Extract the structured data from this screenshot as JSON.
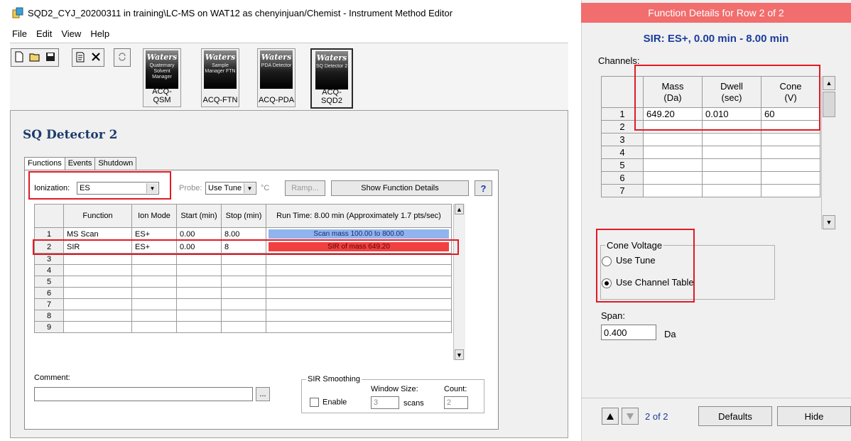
{
  "window": {
    "title": "SQD2_CYJ_20200311 in training\\LC-MS on WAT12 as chenyinjuan/Chemist - Instrument Method Editor"
  },
  "menu": [
    "File",
    "Edit",
    "View",
    "Help"
  ],
  "toolbar": {
    "modules": [
      {
        "brand": "Waters",
        "sub": "Quaternary Solvent Manager",
        "label": "ACQ-QSM"
      },
      {
        "brand": "Waters",
        "sub": "Sample Manager FTN",
        "label": "ACQ-FTN"
      },
      {
        "brand": "Waters",
        "sub": "PDA Detector",
        "label": "ACQ-PDA"
      },
      {
        "brand": "Waters",
        "sub": "SQ Detector 2",
        "label": "ACQ-SQD2"
      }
    ]
  },
  "main": {
    "heading": "SQ Detector 2",
    "tabs": [
      "Functions",
      "Events",
      "Shutdown"
    ],
    "ionization_label": "Ionization:",
    "ionization_value": "ES",
    "probe_label": "Probe:",
    "probe_value": "Use Tune",
    "probe_unit": "°C",
    "ramp_label": "Ramp...",
    "show_details_label": "Show Function Details",
    "help_label": "?",
    "table": {
      "headers": [
        "Function",
        "Ion Mode",
        "Start (min)",
        "Stop (min)",
        "Run Time: 8.00 min (Approximately 1.7 pts/sec)"
      ],
      "rows": [
        {
          "num": "1",
          "function": "MS Scan",
          "ion_mode": "ES+",
          "start": "0.00",
          "stop": "8.00",
          "bar": "Scan mass 100.00 to 800.00",
          "bar_color": "#8fb4ef"
        },
        {
          "num": "2",
          "function": "SIR",
          "ion_mode": "ES+",
          "start": "0.00",
          "stop": "8",
          "bar": "SIR of mass 649.20",
          "bar_color": "#f04040"
        },
        {
          "num": "3"
        },
        {
          "num": "4"
        },
        {
          "num": "5"
        },
        {
          "num": "6"
        },
        {
          "num": "7"
        },
        {
          "num": "8"
        },
        {
          "num": "9"
        }
      ]
    },
    "comment_label": "Comment:",
    "comment_value": "",
    "browse_label": "...",
    "sir_smoothing": {
      "legend": "SIR Smoothing",
      "enable_label": "Enable",
      "window_size_label": "Window Size:",
      "window_size_value": "3",
      "scans_label": "scans",
      "count_label": "Count:",
      "count_value": "2"
    }
  },
  "details": {
    "title": "Function Details for Row 2 of 2",
    "subtitle": "SIR: ES+, 0.00 min - 8.00 min",
    "channels_label": "Channels:",
    "columns": [
      {
        "l1": "Mass",
        "l2": "(Da)"
      },
      {
        "l1": "Dwell",
        "l2": "(sec)"
      },
      {
        "l1": "Cone",
        "l2": "(V)"
      }
    ],
    "rows": [
      {
        "num": "1",
        "mass": "649.20",
        "dwell": "0.010",
        "cone": "60"
      },
      {
        "num": "2"
      },
      {
        "num": "3"
      },
      {
        "num": "4"
      },
      {
        "num": "5"
      },
      {
        "num": "6"
      },
      {
        "num": "7"
      }
    ],
    "cone_voltage": {
      "legend": "Cone Voltage",
      "options": [
        "Use Tune",
        "Use Channel Table"
      ],
      "selected": "Use Channel Table"
    },
    "span_label": "Span:",
    "span_value": "0.400",
    "span_unit": "Da",
    "nav": {
      "page": "2 of 2",
      "defaults": "Defaults",
      "hide": "Hide"
    }
  }
}
